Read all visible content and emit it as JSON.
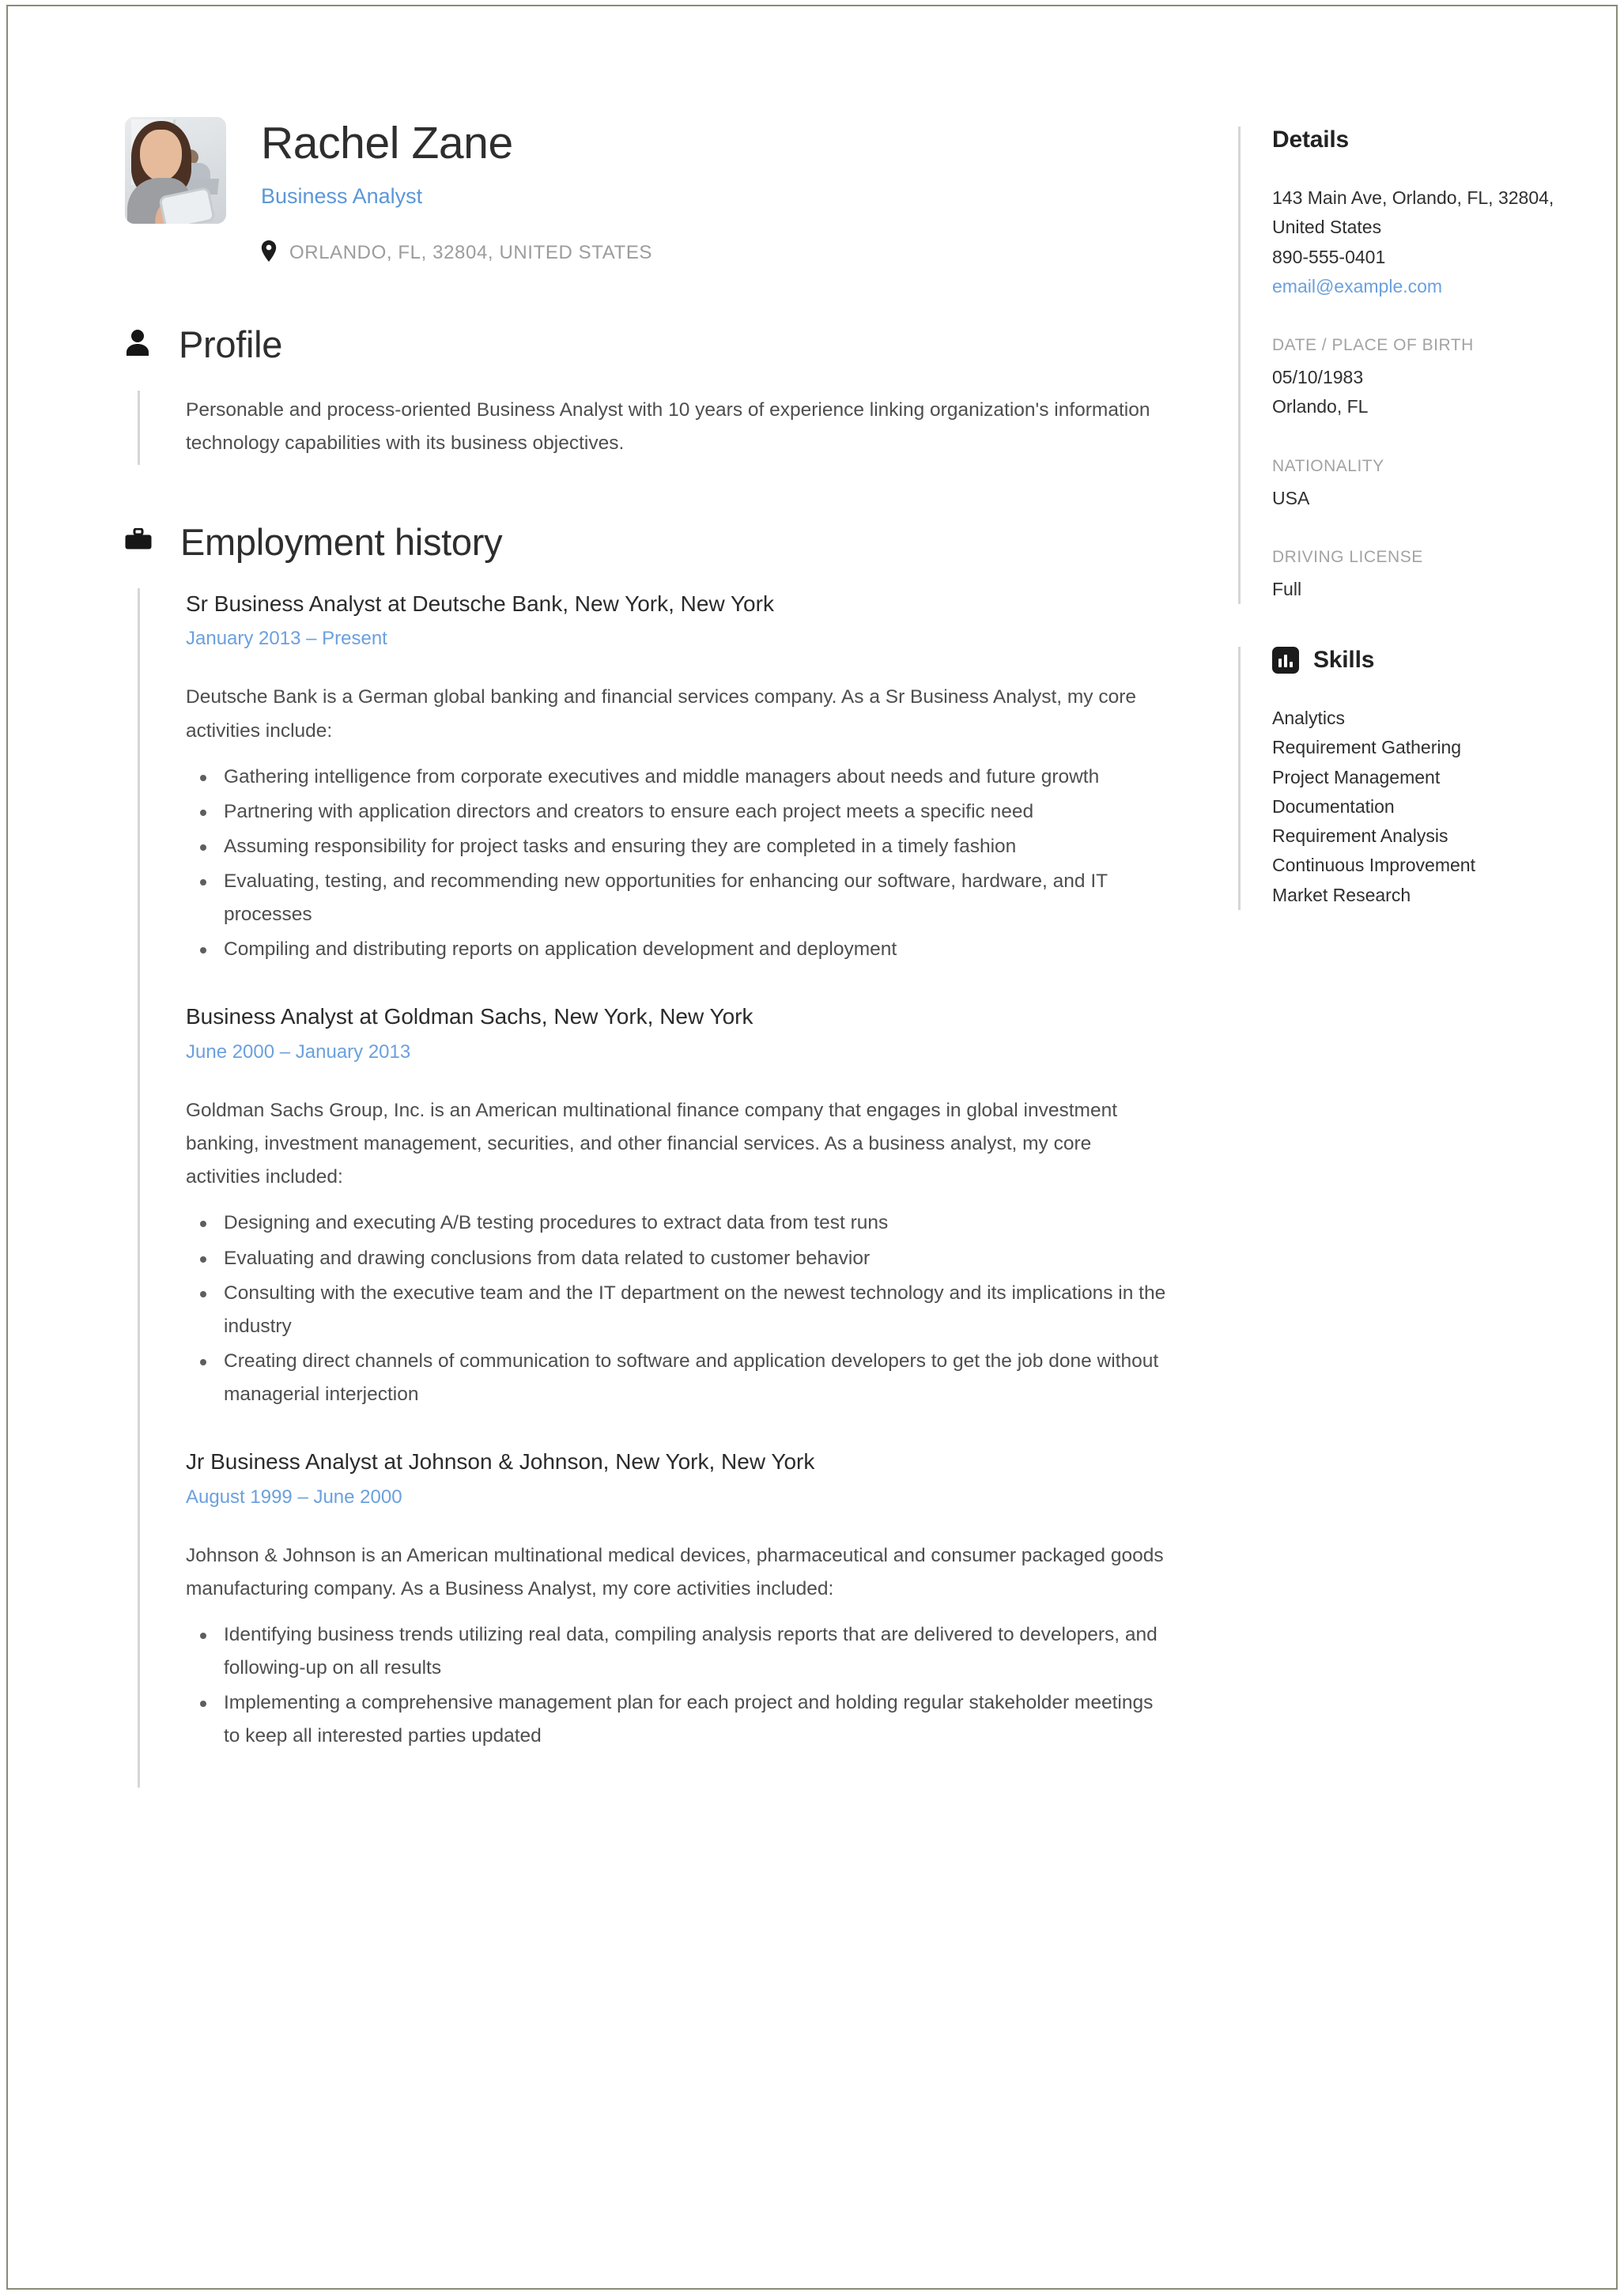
{
  "colors": {
    "accent_blue": "#6ba0dd",
    "title_blue": "#5b97d8",
    "text_dark": "#2e2e2e",
    "text_body": "#4e4e4e",
    "muted_gray": "#9c9c9c",
    "rule_gray": "#d6d6d6",
    "page_border": "#8a8a78"
  },
  "header": {
    "avatar_alt": "profile-photo",
    "full_name": "Rachel Zane",
    "job_title": "Business Analyst",
    "location_icon": "map-pin-icon",
    "location": "ORLANDO, FL, 32804, UNITED STATES"
  },
  "profile": {
    "icon": "person-icon",
    "title": "Profile",
    "text": "Personable and process-oriented Business Analyst with 10 years of experience linking organization's information technology capabilities with its business objectives."
  },
  "employment": {
    "icon": "briefcase-icon",
    "title": "Employment history",
    "jobs": [
      {
        "heading": "Sr Business Analyst at Deutsche Bank, New York, New York",
        "dates": "January 2013  –  Present",
        "description": "Deutsche Bank is a German global banking and financial services company. As a Sr Business Analyst, my core activities include:",
        "bullets": [
          "Gathering intelligence from corporate executives and middle managers about needs and future growth",
          "Partnering with application directors and creators to ensure each project meets a specific need",
          "Assuming responsibility for project tasks and ensuring they are completed in a timely fashion",
          "Evaluating, testing, and recommending new opportunities for enhancing our software, hardware, and IT processes",
          "Compiling and distributing reports on application development and deployment"
        ]
      },
      {
        "heading": "Business Analyst at Goldman Sachs, New York, New York",
        "dates": "June 2000  –  January 2013",
        "description": "Goldman Sachs Group, Inc. is an American multinational finance company that engages in global investment banking, investment management, securities, and other financial services. As a business analyst, my core activities included:",
        "bullets": [
          "Designing and executing A/B testing procedures to extract data from test runs",
          "Evaluating and drawing conclusions from data related to customer behavior",
          "Consulting with the executive team and the IT department on the newest technology and its implications in the industry",
          "Creating direct channels of communication to software and application developers to get the job done without managerial interjection"
        ]
      },
      {
        "heading": "Jr Business Analyst at Johnson & Johnson, New York, New York",
        "dates": "August 1999  –  June 2000",
        "description": "Johnson & Johnson is an American multinational medical devices, pharmaceutical and consumer packaged goods manufacturing company. As a Business Analyst, my core activities included:",
        "bullets": [
          "Identifying business trends utilizing real data, compiling analysis reports that are delivered to developers, and following-up on all results",
          "Implementing a comprehensive management plan for each project and holding regular stakeholder meetings to keep all interested parties updated"
        ]
      }
    ]
  },
  "details": {
    "title": "Details",
    "address": "143 Main Ave, Orlando, FL, 32804, United States",
    "phone": "890-555-0401",
    "email": "email@example.com",
    "dob_label": "DATE / PLACE OF BIRTH",
    "dob_date": "05/10/1983",
    "dob_place": "Orlando, FL",
    "nationality_label": "NATIONALITY",
    "nationality_value": "USA",
    "license_label": "DRIVING LICENSE",
    "license_value": "Full"
  },
  "skills": {
    "icon": "bar-chart-icon",
    "title": "Skills",
    "items": [
      "Analytics",
      "Requirement Gathering",
      "Project Management",
      "Documentation",
      "Requirement Analysis",
      "Continuous Improvement",
      "Market Research"
    ]
  }
}
